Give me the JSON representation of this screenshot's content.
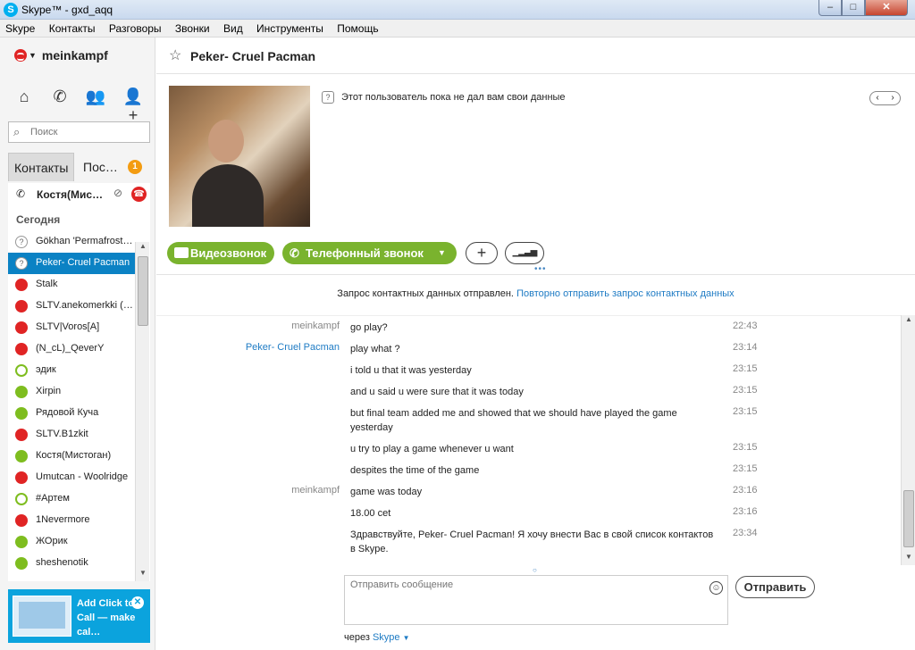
{
  "window": {
    "title": "Skype™ - gxd_aqq",
    "app_icon": "S",
    "min_label": "–",
    "max_label": "□",
    "close_label": "✕"
  },
  "menu": [
    "Skype",
    "Контакты",
    "Разговоры",
    "Звонки",
    "Вид",
    "Инструменты",
    "Помощь"
  ],
  "profile": {
    "username": "meinkampf",
    "status": "busy"
  },
  "nav_icons": [
    "home-icon",
    "phone-icon",
    "group-icon",
    "add-contact-icon"
  ],
  "search": {
    "placeholder": "Поиск"
  },
  "tabs": {
    "contacts": "Контакты",
    "recent": "Пос…",
    "recent_badge": "1"
  },
  "active_call": {
    "name": "Костя(Мис…"
  },
  "section_today": "Сегодня",
  "contacts": [
    {
      "name": "Gökhan 'Permafrost…",
      "status": "pending"
    },
    {
      "name": "Peker- Cruel Pacman",
      "status": "pending",
      "selected": true
    },
    {
      "name": "Stalk",
      "status": "busy"
    },
    {
      "name": "SLTV.anekomerkki (…",
      "status": "busy"
    },
    {
      "name": "SLTV|Voros[A]",
      "status": "busy"
    },
    {
      "name": "(N_cL)_QeverY",
      "status": "busy"
    },
    {
      "name": "эдик",
      "status": "offline"
    },
    {
      "name": "Xirpin",
      "status": "online"
    },
    {
      "name": "Рядовой Куча",
      "status": "online"
    },
    {
      "name": "SLTV.B1zkit",
      "status": "busy"
    },
    {
      "name": "Костя(Мистоган)",
      "status": "online"
    },
    {
      "name": "Umutcan - Woolridge",
      "status": "busy"
    },
    {
      "name": "#Артем",
      "status": "offline"
    },
    {
      "name": "1Nevermore",
      "status": "busy"
    },
    {
      "name": "ЖОрик",
      "status": "online"
    },
    {
      "name": "sheshenotik",
      "status": "online"
    }
  ],
  "ad": {
    "text": "Add Click to Call — make cal…"
  },
  "contact_header": {
    "name": "Peker- Cruel Pacman"
  },
  "profile_info": {
    "text": "Этот пользователь пока не дал вам свои данные"
  },
  "actions": {
    "video": "Видеозвонок",
    "phone": "Телефонный звонок",
    "add": "+",
    "signal": "▁▂▃▅"
  },
  "notice": {
    "text": "Запрос контактных данных отправлен.",
    "link": "Повторно отправить запрос контактных данных"
  },
  "messages": [
    {
      "sender": "meinkampf",
      "who": "me",
      "text": "go play?",
      "time": "22:43"
    },
    {
      "sender": "Peker- Cruel Pacman",
      "who": "other",
      "text": "play what ?",
      "time": "23:14"
    },
    {
      "sender": "",
      "who": "other",
      "text": "i told u that it was yesterday",
      "time": "23:15"
    },
    {
      "sender": "",
      "who": "other",
      "text": "and u said u were sure that it was today",
      "time": "23:15"
    },
    {
      "sender": "",
      "who": "other",
      "text": "but final team added me and showed that we should have played the game yesterday",
      "time": "23:15"
    },
    {
      "sender": "",
      "who": "other",
      "text": "u try to play a game whenever u want",
      "time": "23:15"
    },
    {
      "sender": "",
      "who": "other",
      "text": "despites the time of the game",
      "time": "23:15"
    },
    {
      "sender": "meinkampf",
      "who": "me",
      "text": "game was today",
      "time": "23:16"
    },
    {
      "sender": "",
      "who": "me",
      "text": "18.00 cet",
      "time": "23:16"
    },
    {
      "sender": "",
      "who": "me",
      "text": "Здравствуйте, Peker- Cruel Pacman! Я хочу внести Вас в свой список контактов в Skype.",
      "time": "23:34"
    }
  ],
  "composer": {
    "placeholder": "Отправить сообщение",
    "send": "Отправить",
    "via_prefix": "через",
    "via_link": "Skype"
  }
}
